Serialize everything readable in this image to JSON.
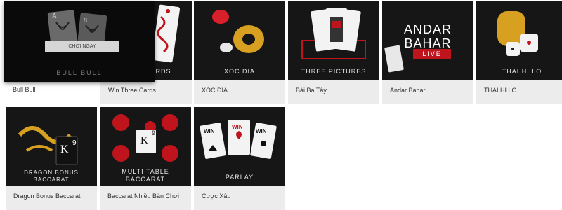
{
  "bull_bull": {
    "thumb_title": "BULL BULL",
    "play_button": "CHƠI NGAY",
    "name": "Bull Bull",
    "card_letters": [
      "A",
      "8"
    ]
  },
  "games": [
    {
      "name": "Win Three Cards",
      "thumb_title": "CARDS"
    },
    {
      "name": "XÓC ĐĨA",
      "thumb_title": "XOC DIA"
    },
    {
      "name": "Bài Ba Tây",
      "thumb_title": "THREE PICTURES"
    },
    {
      "name": "Andar Bahar",
      "thumb_lines": [
        "ANDAR",
        "BAHAR"
      ],
      "thumb_badge": "LIVE"
    },
    {
      "name": "THAI HI LO",
      "thumb_title": "THAI HI LO"
    },
    {
      "name": "Dragon Bonus Baccarat",
      "thumb_lines": [
        "DRAGON BONUS",
        "BACCARAT"
      ],
      "card": "K",
      "card_num": "9"
    },
    {
      "name": "Baccarat Nhiều Bàn Chơi",
      "thumb_lines": [
        "MULTI TABLE",
        "BACCARAT"
      ],
      "card": "K",
      "card_num": "9"
    },
    {
      "name": "Cược Xâu",
      "thumb_title": "PARLAY",
      "cards": [
        "WIN",
        "WIN",
        "WIN"
      ]
    }
  ],
  "colors": {
    "accent_red": "#c0141c",
    "gold": "#d8a020",
    "tile_bg": "#ececec",
    "thumb_bg": "#161616"
  }
}
